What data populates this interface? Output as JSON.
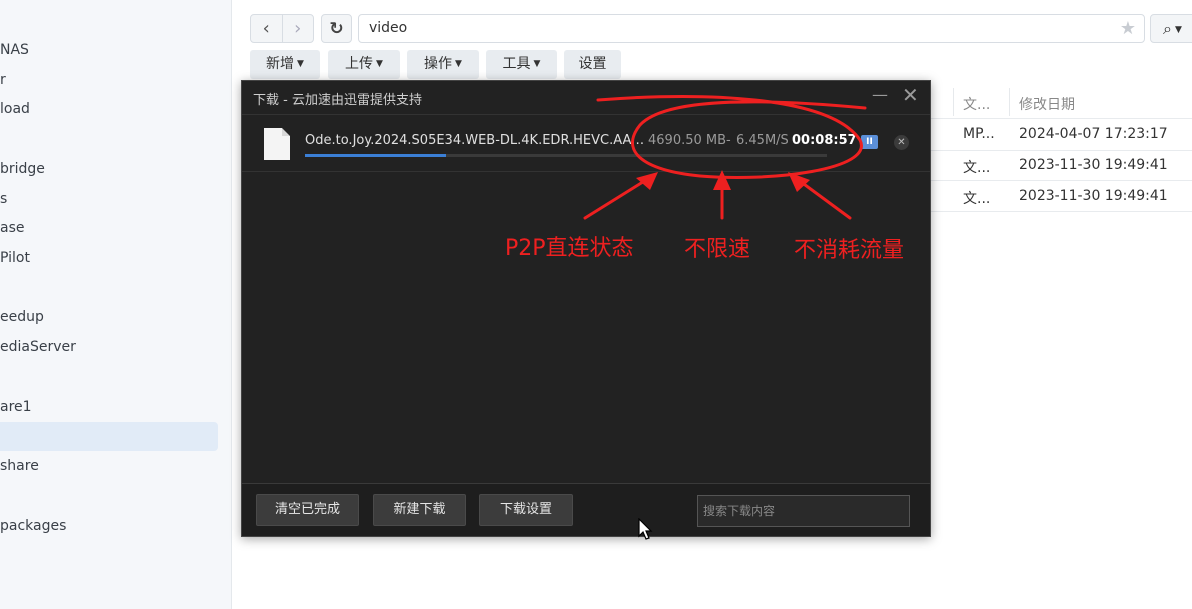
{
  "sidebar": {
    "items": [
      {
        "label": ""
      },
      {
        "label": "NAS"
      },
      {
        "label": "r"
      },
      {
        "label": "load"
      },
      {
        "label": "bridge"
      },
      {
        "label": "s"
      },
      {
        "label": "ase"
      },
      {
        "label": "Pilot"
      },
      {
        "label": "eedup"
      },
      {
        "label": "ediaServer"
      },
      {
        "label": "are1"
      },
      {
        "label": ""
      },
      {
        "label": "share"
      },
      {
        "label": "packages"
      }
    ]
  },
  "toolbar": {
    "back_icon": "‹",
    "forward_icon": "›",
    "refresh_icon": "↻",
    "path": "video",
    "star_icon": "★",
    "search_icon": "⌕",
    "menus": [
      "新增",
      "上传",
      "操作",
      "工具",
      "设置"
    ]
  },
  "file_list": {
    "columns": [
      "文...",
      "修改日期"
    ],
    "rows": [
      {
        "type": "MP...",
        "modified": "2024-04-07 17:23:17"
      },
      {
        "type": "文...",
        "modified": "2023-11-30 19:49:41"
      },
      {
        "type": "文...",
        "modified": "2023-11-30 19:49:41"
      }
    ]
  },
  "dialog": {
    "title": "下载 - 云加速由迅雷提供支持",
    "min_icon": "—",
    "close_icon": "✕",
    "download": {
      "name": "Ode.to.Joy.2024.S05E34.WEB-DL.4K.EDR.HEVC.AAC-C...",
      "size": "4690.50 MB",
      "sep": "-",
      "speed": "6.45M/S",
      "eta": "00:08:57",
      "progress": 0.27,
      "pause_icon": "II",
      "remove_icon": "✕"
    },
    "footer": {
      "clear_btn": "清空已完成",
      "new_btn": "新建下载",
      "settings_btn": "下载设置",
      "search_placeholder": "搜索下载内容"
    }
  },
  "annotations": {
    "label1": "P2P直连状态",
    "label2": "不限速",
    "label3": "不消耗流量",
    "color": "#ee2020"
  }
}
